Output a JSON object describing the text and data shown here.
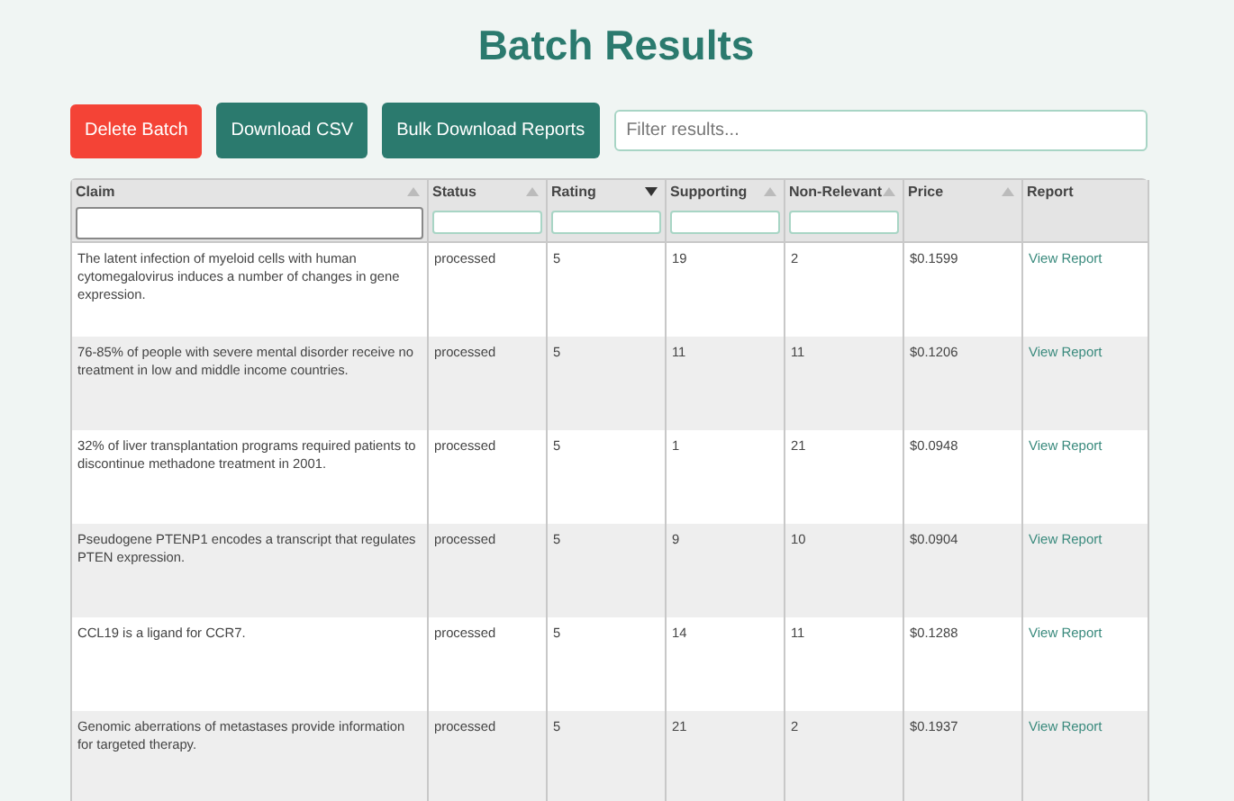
{
  "title": "Batch Results",
  "buttons": [
    {
      "label": "Delete Batch",
      "kind": "danger"
    },
    {
      "label": "Download CSV",
      "kind": "primary"
    },
    {
      "label": "Bulk Download Reports",
      "kind": "primary"
    }
  ],
  "search": {
    "placeholder": "Filter results..."
  },
  "table": {
    "columns": [
      {
        "label": "Claim",
        "sorted": false,
        "filter": true
      },
      {
        "label": "Status",
        "sorted": false,
        "filter": true
      },
      {
        "label": "Rating",
        "sorted": true,
        "filter": true
      },
      {
        "label": "Supporting",
        "sorted": false,
        "filter": true
      },
      {
        "label": "Non-Relevant",
        "sorted": false,
        "filter": true
      },
      {
        "label": "Price",
        "sorted": false,
        "filter": false
      },
      {
        "label": "Report",
        "filter": false
      }
    ],
    "rows": [
      {
        "claim": "The latent infection of myeloid cells with human cytomegalovirus induces a number of changes in gene expression.",
        "status": "processed",
        "rating": "5",
        "supporting": "19",
        "non_relevant": "2",
        "price": "$0.1599",
        "report": "View Report"
      },
      {
        "claim": "76-85% of people with severe mental disorder receive no treatment in low and middle income countries.",
        "status": "processed",
        "rating": "5",
        "supporting": "11",
        "non_relevant": "11",
        "price": "$0.1206",
        "report": "View Report"
      },
      {
        "claim": "32% of liver transplantation programs required patients to discontinue methadone treatment in 2001.",
        "status": "processed",
        "rating": "5",
        "supporting": "1",
        "non_relevant": "21",
        "price": "$0.0948",
        "report": "View Report"
      },
      {
        "claim": "Pseudogene PTENP1 encodes a transcript that regulates PTEN expression.",
        "status": "processed",
        "rating": "5",
        "supporting": "9",
        "non_relevant": "10",
        "price": "$0.0904",
        "report": "View Report"
      },
      {
        "claim": "CCL19 is a ligand for CCR7.",
        "status": "processed",
        "rating": "5",
        "supporting": "14",
        "non_relevant": "11",
        "price": "$0.1288",
        "report": "View Report"
      },
      {
        "claim": "Genomic aberrations of metastases provide information for targeted therapy.",
        "status": "processed",
        "rating": "5",
        "supporting": "21",
        "non_relevant": "2",
        "price": "$0.1937",
        "report": "View Report"
      }
    ]
  }
}
